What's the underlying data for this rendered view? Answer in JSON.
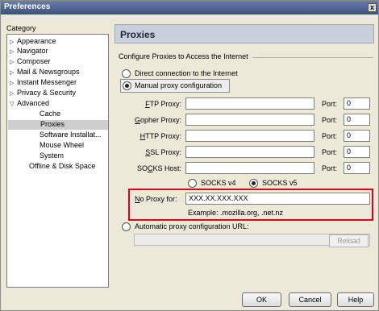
{
  "window": {
    "title": "Preferences",
    "close": "x"
  },
  "category_label": "Category",
  "sidebar": {
    "items": [
      {
        "label": "Appearance",
        "arrow": "right"
      },
      {
        "label": "Navigator",
        "arrow": "right"
      },
      {
        "label": "Composer",
        "arrow": "right"
      },
      {
        "label": "Mail & Newsgroups",
        "arrow": "right"
      },
      {
        "label": "Instant Messenger",
        "arrow": "right"
      },
      {
        "label": "Privacy & Security",
        "arrow": "right"
      },
      {
        "label": "Advanced",
        "arrow": "down"
      },
      {
        "label": "Cache"
      },
      {
        "label": "Proxies",
        "selected": true
      },
      {
        "label": "Software Installat..."
      },
      {
        "label": "Mouse Wheel"
      },
      {
        "label": "System"
      },
      {
        "label": "Offline & Disk Space"
      }
    ]
  },
  "header": {
    "title": "Proxies"
  },
  "group": {
    "title": "Configure Proxies to Access the Internet"
  },
  "options": {
    "direct": "Direct connection to the Internet",
    "manual": "Manual proxy configuration",
    "auto": "Automatic proxy configuration URL:"
  },
  "proxies": [
    {
      "label_pre": "",
      "label_key": "F",
      "label_post": "TP Proxy:",
      "value": "",
      "port_label": "Port:",
      "port": "0"
    },
    {
      "label_pre": "",
      "label_key": "G",
      "label_post": "opher Proxy:",
      "value": "",
      "port_label": "Port:",
      "port": "0"
    },
    {
      "label_pre": "",
      "label_key": "H",
      "label_post": "TTP Proxy:",
      "value": "",
      "port_label": "Port:",
      "port": "0"
    },
    {
      "label_pre": "",
      "label_key": "S",
      "label_post": "SL Proxy:",
      "value": "",
      "port_label": "Port:",
      "port": "0"
    },
    {
      "label_pre": "SO",
      "label_key": "C",
      "label_post": "KS Host:",
      "value": "",
      "port_label": "Port:",
      "port": "0"
    }
  ],
  "socks": {
    "v4": "SOCKS v4",
    "v5": "SOCKS v5"
  },
  "no_proxy": {
    "label_key": "N",
    "label_post": "o Proxy for:",
    "value": "XXX.XX.XXX.XXX",
    "example": "Example: .mozilla.org, .net.nz"
  },
  "auto_url": {
    "value": "",
    "reload": "Reload"
  },
  "buttons": {
    "ok": "OK",
    "cancel": "Cancel",
    "help": "Help"
  }
}
